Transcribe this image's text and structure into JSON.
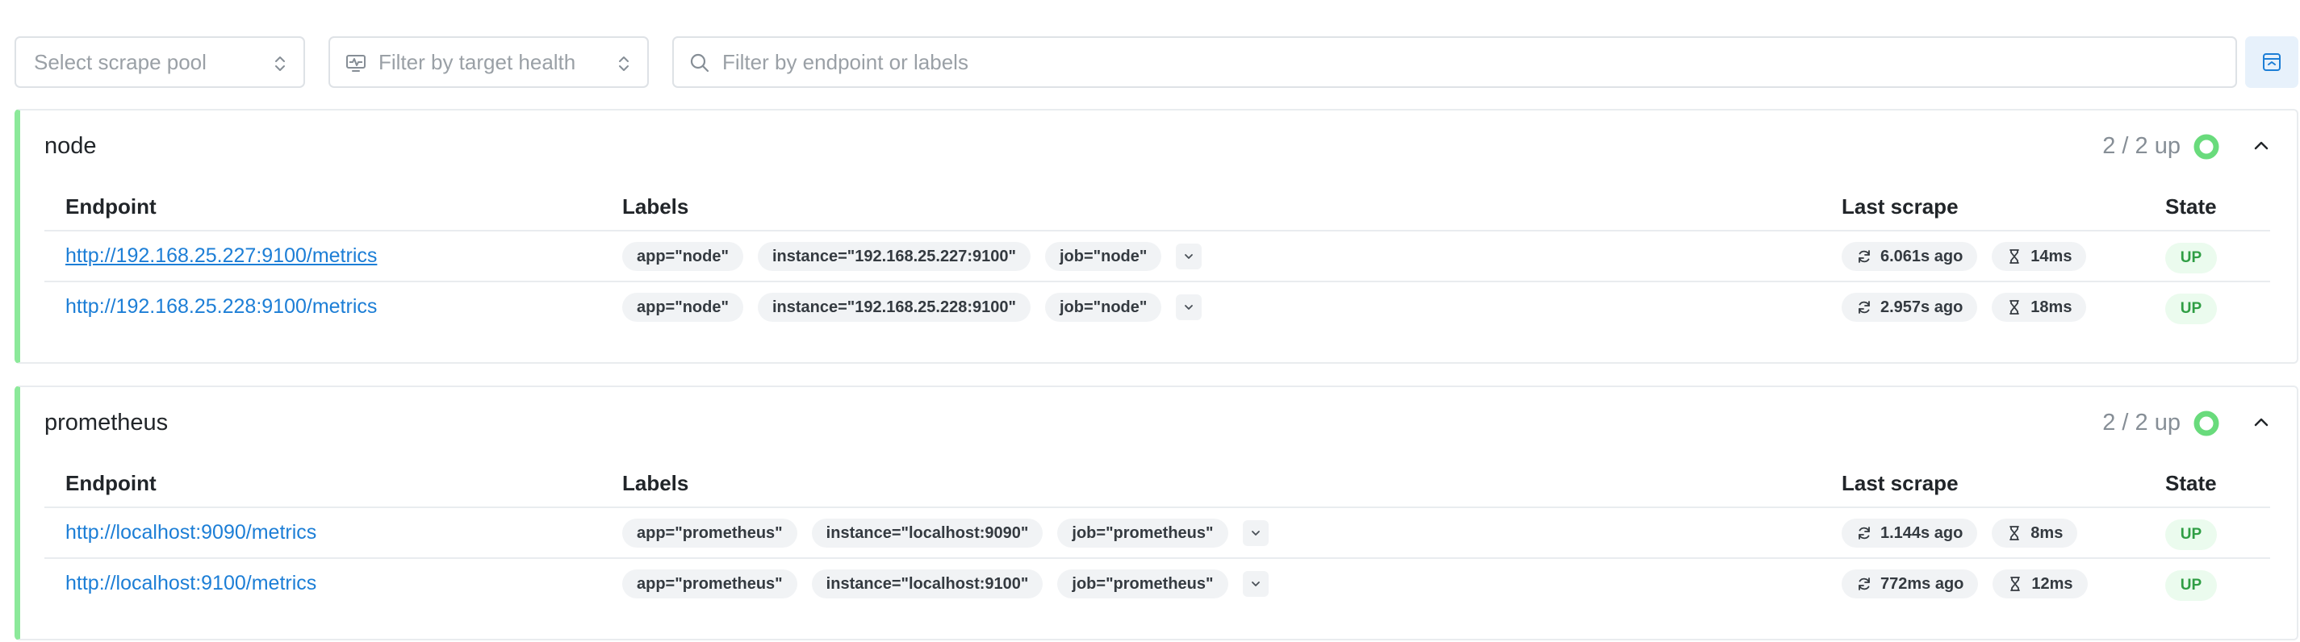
{
  "filters": {
    "pool_placeholder": "Select scrape pool",
    "health_placeholder": "Filter by target health",
    "search_placeholder": "Filter by endpoint or labels"
  },
  "columns": {
    "endpoint": "Endpoint",
    "labels": "Labels",
    "last_scrape": "Last scrape",
    "state": "State"
  },
  "pools": [
    {
      "name": "node",
      "count": "2 / 2 up",
      "targets": [
        {
          "endpoint": "http://192.168.25.227:9100/metrics",
          "labels": [
            "app=\"node\"",
            "instance=\"192.168.25.227:9100\"",
            "job=\"node\""
          ],
          "last_scrape": "6.061s ago",
          "duration": "14ms",
          "state": "UP"
        },
        {
          "endpoint": "http://192.168.25.228:9100/metrics",
          "labels": [
            "app=\"node\"",
            "instance=\"192.168.25.228:9100\"",
            "job=\"node\""
          ],
          "last_scrape": "2.957s ago",
          "duration": "18ms",
          "state": "UP"
        }
      ]
    },
    {
      "name": "prometheus",
      "count": "2 / 2 up",
      "targets": [
        {
          "endpoint": "http://localhost:9090/metrics",
          "labels": [
            "app=\"prometheus\"",
            "instance=\"localhost:9090\"",
            "job=\"prometheus\""
          ],
          "last_scrape": "1.144s ago",
          "duration": "8ms",
          "state": "UP"
        },
        {
          "endpoint": "http://localhost:9100/metrics",
          "labels": [
            "app=\"prometheus\"",
            "instance=\"localhost:9100\"",
            "job=\"prometheus\""
          ],
          "last_scrape": "772ms ago",
          "duration": "12ms",
          "state": "UP"
        }
      ]
    }
  ],
  "colors": {
    "accent": "#1c7ed6",
    "healthy": "#8ce99a",
    "up_text": "#2f9e44",
    "ring": "#69db7c"
  },
  "icons": {
    "pool_select": "chevron-up-down-icon",
    "health_filter": "monitor-heart-icon",
    "search": "search-icon",
    "layout_toggle": "layout-collapse-icon",
    "pool_health": "health-ring-icon",
    "collapse": "chevron-up-icon",
    "more_labels": "chevron-down-icon",
    "last_scrape": "refresh-icon",
    "duration": "hourglass-icon"
  }
}
